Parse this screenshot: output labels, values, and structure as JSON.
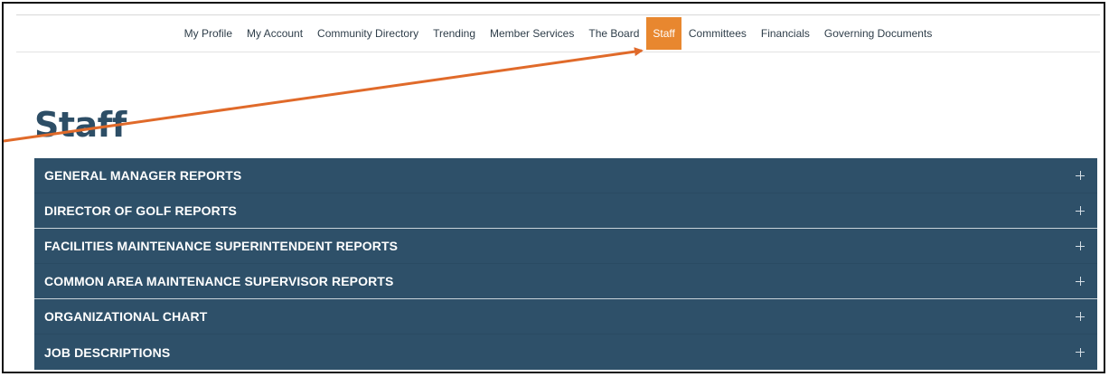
{
  "nav": {
    "items": [
      {
        "label": "My Profile",
        "active": false
      },
      {
        "label": "My Account",
        "active": false
      },
      {
        "label": "Community Directory",
        "active": false
      },
      {
        "label": "Trending",
        "active": false
      },
      {
        "label": "Member Services",
        "active": false
      },
      {
        "label": "The Board",
        "active": false
      },
      {
        "label": "Staff",
        "active": true
      },
      {
        "label": "Committees",
        "active": false
      },
      {
        "label": "Financials",
        "active": false
      },
      {
        "label": "Governing Documents",
        "active": false
      }
    ]
  },
  "page": {
    "title": "Staff"
  },
  "accordion": {
    "items": [
      {
        "label": "GENERAL MANAGER REPORTS"
      },
      {
        "label": "DIRECTOR OF GOLF REPORTS"
      },
      {
        "label": "FACILITIES MAINTENANCE SUPERINTENDENT REPORTS"
      },
      {
        "label": "COMMON AREA MAINTENANCE SUPERVISOR REPORTS"
      },
      {
        "label": "ORGANIZATIONAL CHART"
      },
      {
        "label": "JOB DESCRIPTIONS"
      }
    ]
  },
  "colors": {
    "accent": "#e8872f",
    "panel": "#2e5069",
    "title": "#2d4e66"
  },
  "icons": {
    "expand": "plus-icon",
    "annotation": "arrow-annotation"
  }
}
